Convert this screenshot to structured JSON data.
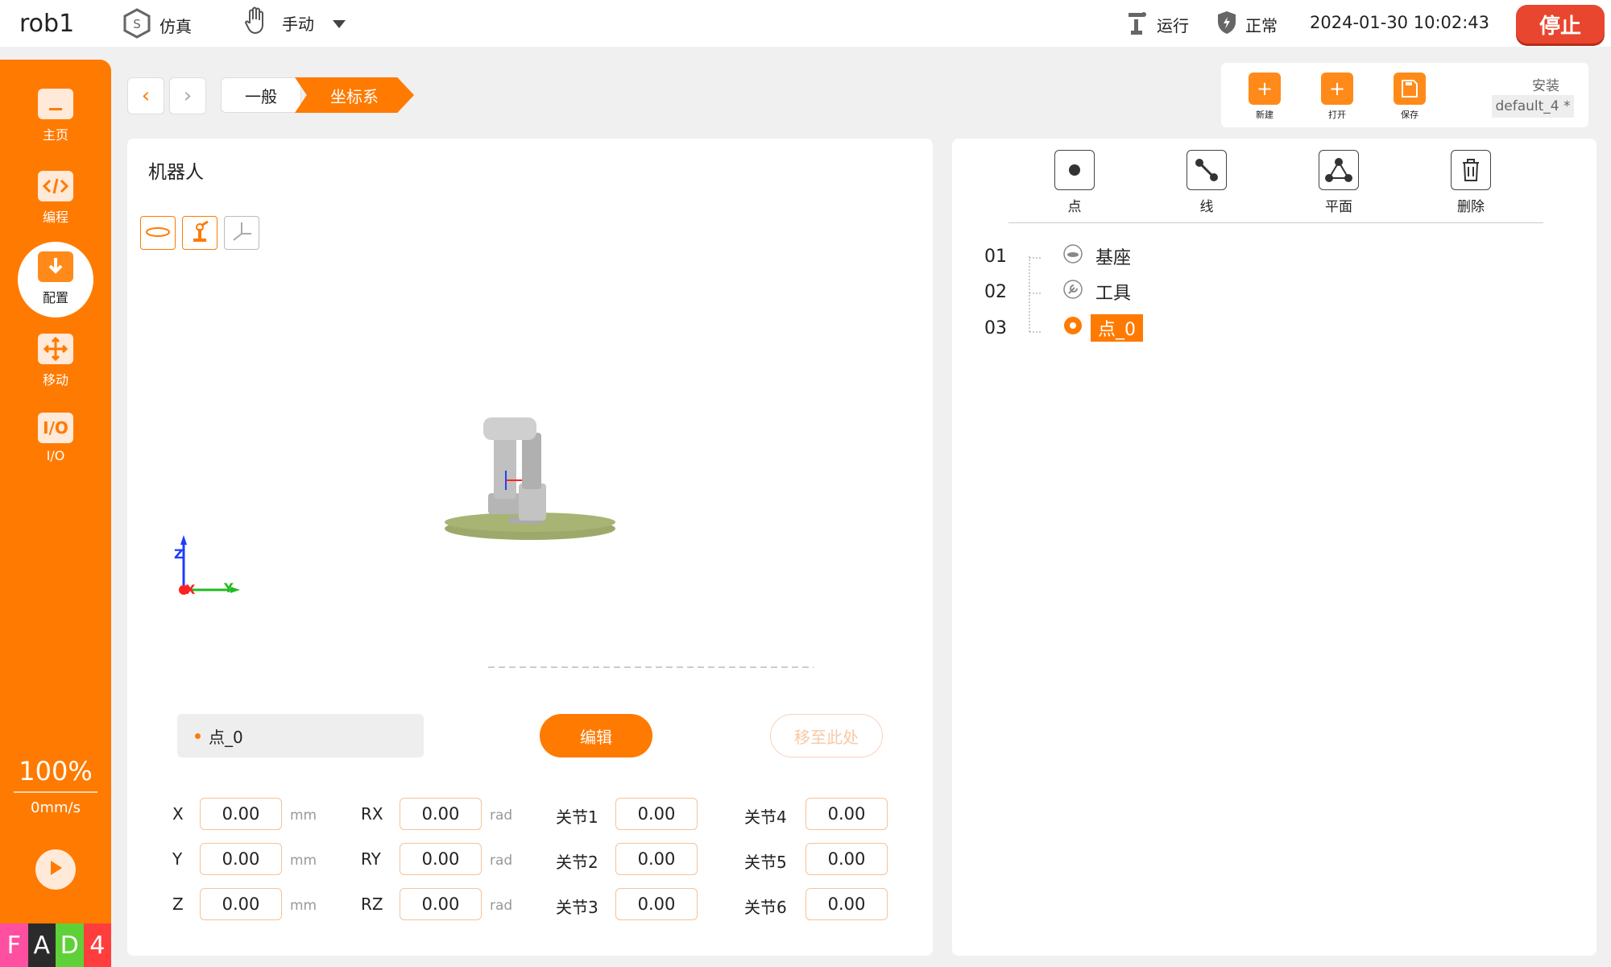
{
  "topbar": {
    "robot_name": "rob1",
    "mode": "仿真",
    "control": "手动",
    "run_state": "运行",
    "health": "正常",
    "datetime": "2024-01-30 10:02:43",
    "stop_label": "停止"
  },
  "sidebar": {
    "items": [
      {
        "label": "主页"
      },
      {
        "label": "编程"
      },
      {
        "label": "配置"
      },
      {
        "label": "移动"
      },
      {
        "label": "I/O"
      }
    ],
    "io_icon_text": "I/O",
    "speed_percent": "100%",
    "speed_value": "0mm/s"
  },
  "fad": [
    "F",
    "A",
    "D",
    "4"
  ],
  "breadcrumb": {
    "items": [
      "一般",
      "坐标系"
    ]
  },
  "toolbar": {
    "new_label": "新建",
    "open_label": "打开",
    "save_label": "保存",
    "install_label": "安装",
    "install_value": "default_4 *"
  },
  "left_panel": {
    "title": "机器人",
    "axis_labels": {
      "z": "Z",
      "x": "X",
      "y": "Y"
    },
    "selected_feature": "点_0",
    "edit_label": "编辑",
    "move_here_label": "移至此处",
    "fields": [
      {
        "label": "X",
        "value": "0.00",
        "unit": "mm"
      },
      {
        "label": "Y",
        "value": "0.00",
        "unit": "mm"
      },
      {
        "label": "Z",
        "value": "0.00",
        "unit": "mm"
      },
      {
        "label": "RX",
        "value": "0.00",
        "unit": "rad"
      },
      {
        "label": "RY",
        "value": "0.00",
        "unit": "rad"
      },
      {
        "label": "RZ",
        "value": "0.00",
        "unit": "rad"
      }
    ],
    "joints": [
      {
        "label": "关节1",
        "value": "0.00"
      },
      {
        "label": "关节2",
        "value": "0.00"
      },
      {
        "label": "关节3",
        "value": "0.00"
      },
      {
        "label": "关节4",
        "value": "0.00"
      },
      {
        "label": "关节5",
        "value": "0.00"
      },
      {
        "label": "关节6",
        "value": "0.00"
      }
    ]
  },
  "right_panel": {
    "tools": [
      {
        "label": "点"
      },
      {
        "label": "线"
      },
      {
        "label": "平面"
      },
      {
        "label": "删除"
      }
    ],
    "tree": [
      {
        "num": "01",
        "label": "基座"
      },
      {
        "num": "02",
        "label": "工具"
      },
      {
        "num": "03",
        "label": "点_0"
      }
    ]
  },
  "colors": {
    "accent": "#ff7a00",
    "stop": "#e8462e",
    "fad": [
      "#ff4fa0",
      "#2b2b2b",
      "#5fd138",
      "#ff3d3d"
    ]
  }
}
